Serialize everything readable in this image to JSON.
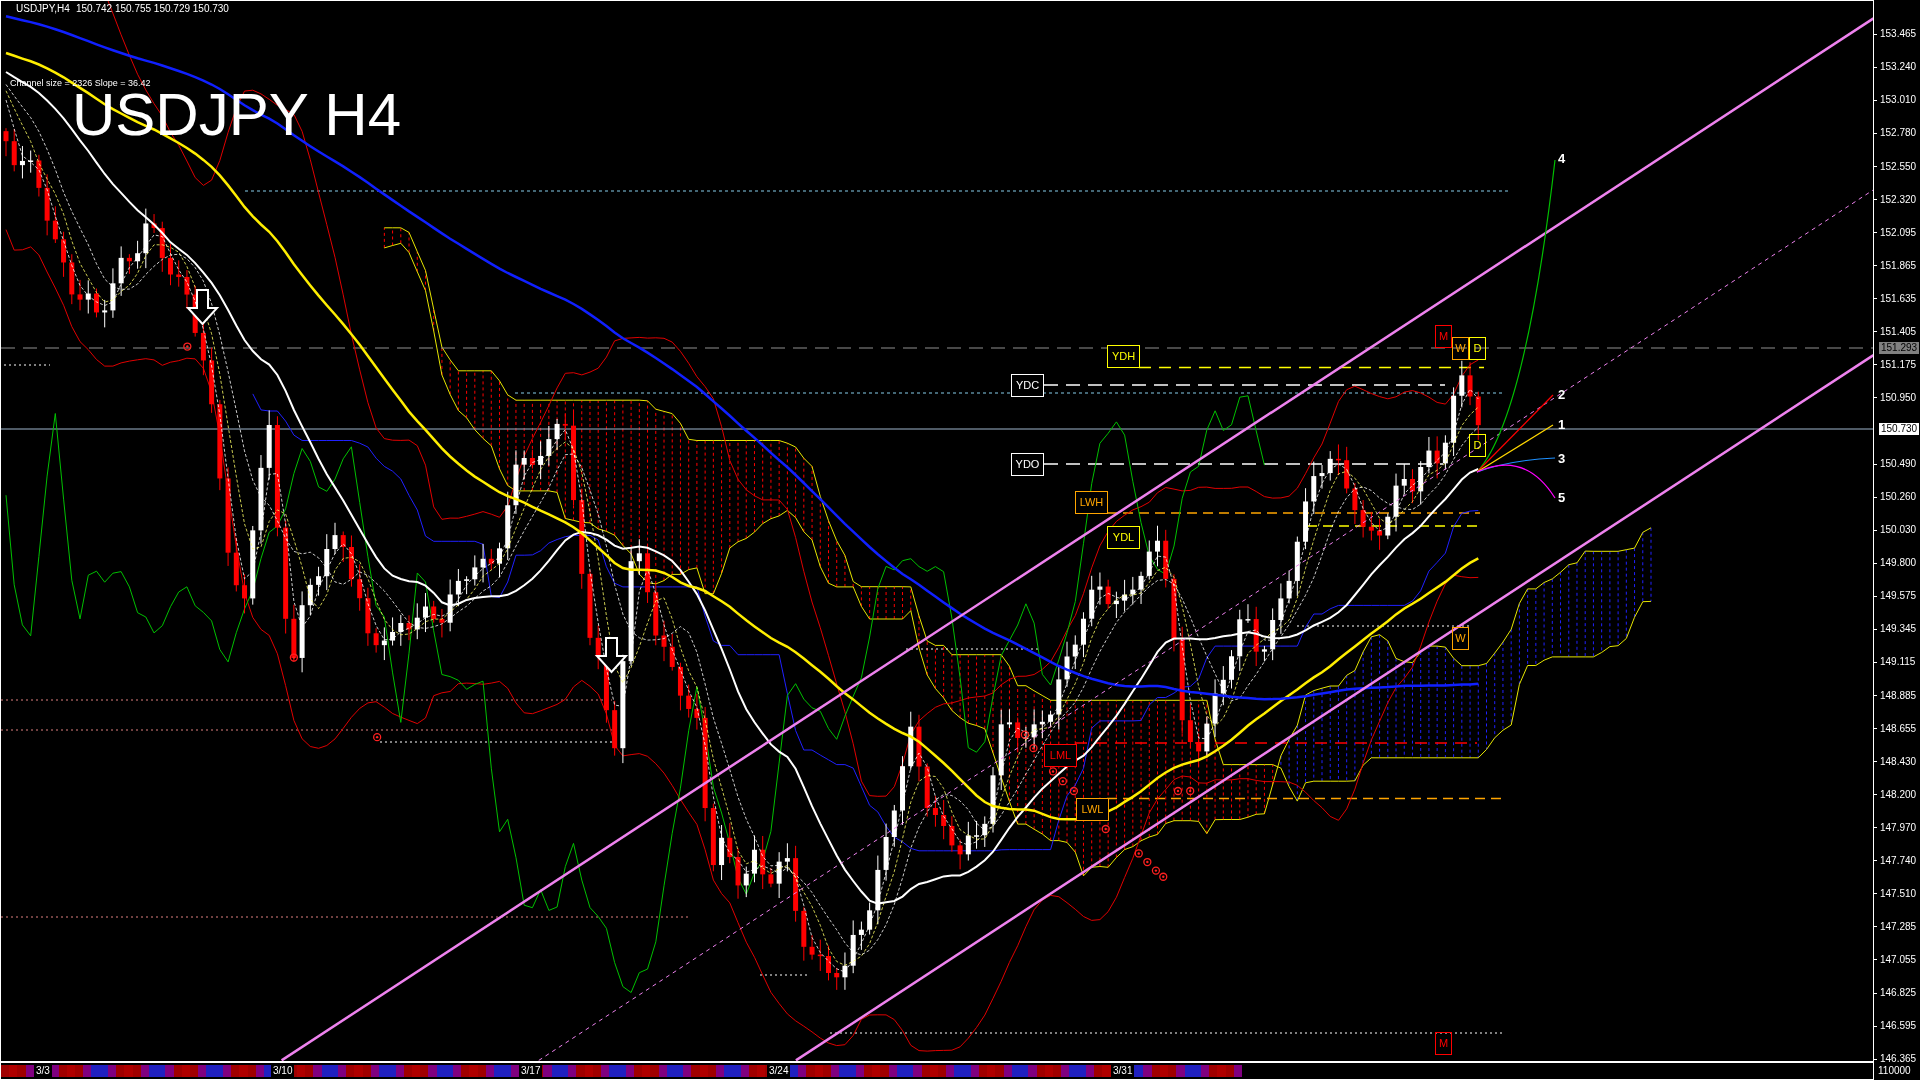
{
  "header": {
    "symbol": "USDJPY,H4",
    "quote": "150.742 150.755 150.729 150.730"
  },
  "channel_info": "Channel size = 2326 Slope = 36.42",
  "title": "USDJPY H4",
  "level_labels": [
    {
      "label": "YDH",
      "color": "#ffff00"
    },
    {
      "label": "YDC",
      "color": "#ffffff"
    },
    {
      "label": "YDO",
      "color": "#ffffff"
    },
    {
      "label": "LWH",
      "color": "#ffa500"
    },
    {
      "label": "YDL",
      "color": "#ffff00"
    },
    {
      "label": "LML",
      "color": "#ff0000"
    },
    {
      "label": "LWL",
      "color": "#ffa500"
    }
  ],
  "period_markers": [
    {
      "label": "M",
      "color": "#ff0000"
    },
    {
      "label": "W",
      "color": "#ffa500"
    },
    {
      "label": "D",
      "color": "#ffff00"
    },
    {
      "label": "D",
      "color": "#ffff00"
    },
    {
      "label": "W",
      "color": "#ffa500"
    },
    {
      "label": "M",
      "color": "#ff0000"
    }
  ],
  "projections": [
    {
      "label": "4",
      "color": "#00c000"
    },
    {
      "label": "2",
      "color": "#ff0000"
    },
    {
      "label": "1",
      "color": "#ffd700"
    },
    {
      "label": "3",
      "color": "#1e90ff"
    },
    {
      "label": "5",
      "color": "#ff00ff"
    }
  ],
  "price_axis": {
    "labels": [
      "153.465",
      "153.240",
      "153.010",
      "152.780",
      "152.550",
      "152.320",
      "152.095",
      "151.865",
      "151.635",
      "151.405",
      "151.175",
      "150.950",
      "150.490",
      "150.260",
      "150.030",
      "149.800",
      "149.575",
      "149.345",
      "149.115",
      "148.885",
      "148.655",
      "148.430",
      "148.200",
      "147.970",
      "147.740",
      "147.510",
      "147.285",
      "147.055",
      "146.825",
      "146.595",
      "146.365"
    ],
    "tags": [
      {
        "label": "151.293",
        "kind": "level"
      },
      {
        "label": "150.730",
        "kind": "bid"
      }
    ]
  },
  "time_axis": {
    "labels": [
      "3/3",
      "3/10",
      "3/17",
      "3/24",
      "3/31"
    ]
  },
  "volume_label": "110000"
}
